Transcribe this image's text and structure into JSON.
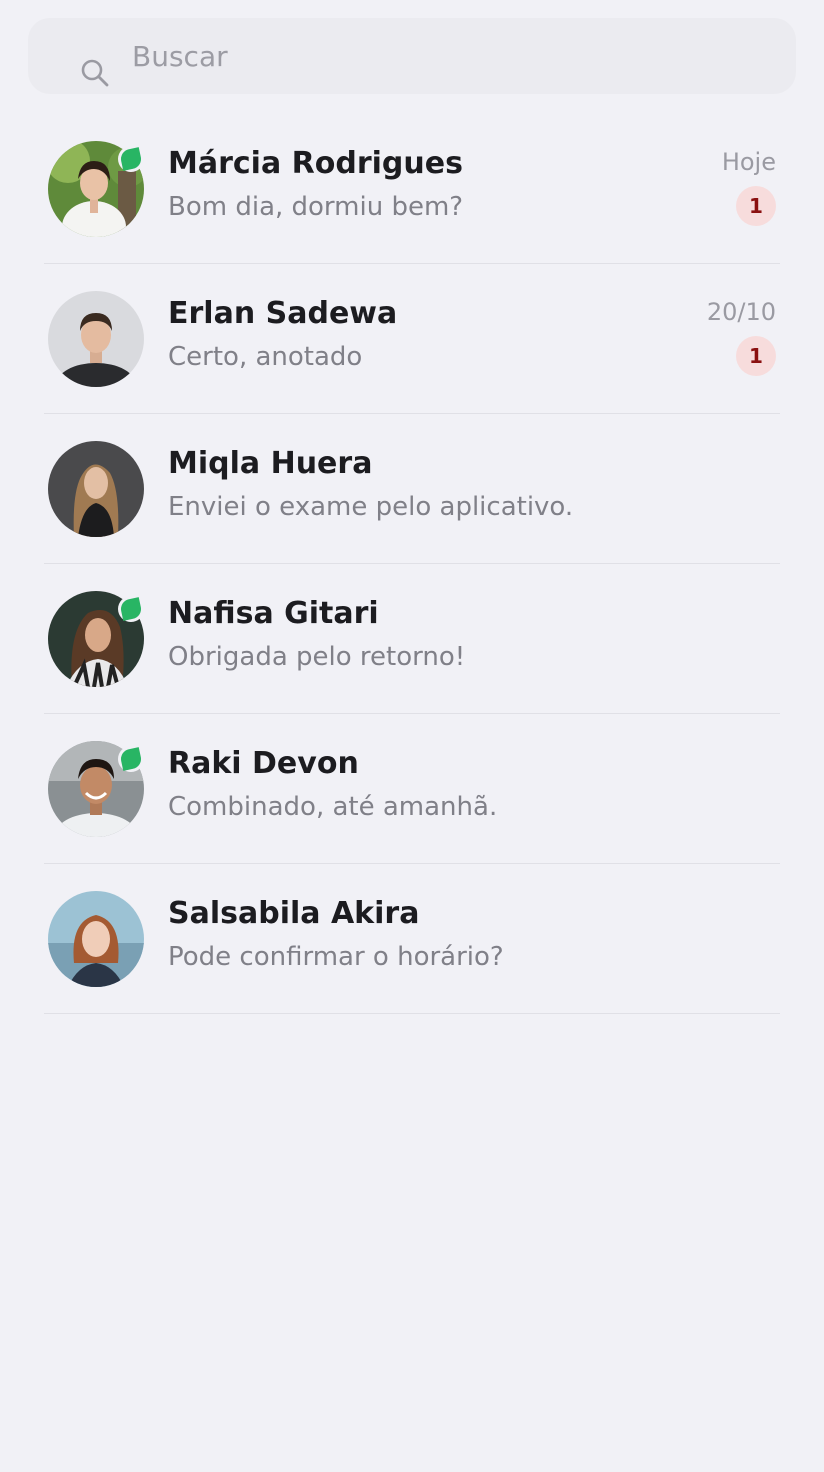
{
  "search": {
    "placeholder": "Buscar",
    "icon": "search-icon"
  },
  "conversations": [
    {
      "name": "Márcia Rodrigues",
      "message": "Bom dia, dormiu bem?",
      "date": "Hoje",
      "unread": "1",
      "online": true
    },
    {
      "name": "Erlan Sadewa",
      "message": "Certo, anotado",
      "date": "20/10",
      "unread": "1",
      "online": false
    },
    {
      "name": "Miqla Huera",
      "message": "Enviei o exame pelo aplicativo.",
      "date": "",
      "unread": "",
      "online": false
    },
    {
      "name": "Nafisa Gitari",
      "message": "Obrigada pelo retorno!",
      "date": "",
      "unread": "",
      "online": true
    },
    {
      "name": "Raki Devon",
      "message": "Combinado, até amanhã.",
      "date": "",
      "unread": "",
      "online": true
    },
    {
      "name": "Salsabila Akira",
      "message": "Pode confirmar o horário?",
      "date": "",
      "unread": "",
      "online": false
    }
  ],
  "colors": {
    "background": "#f1f1f6",
    "online": "#28b564",
    "badge_bg": "#f7dcdc",
    "badge_text": "#8a1010"
  }
}
